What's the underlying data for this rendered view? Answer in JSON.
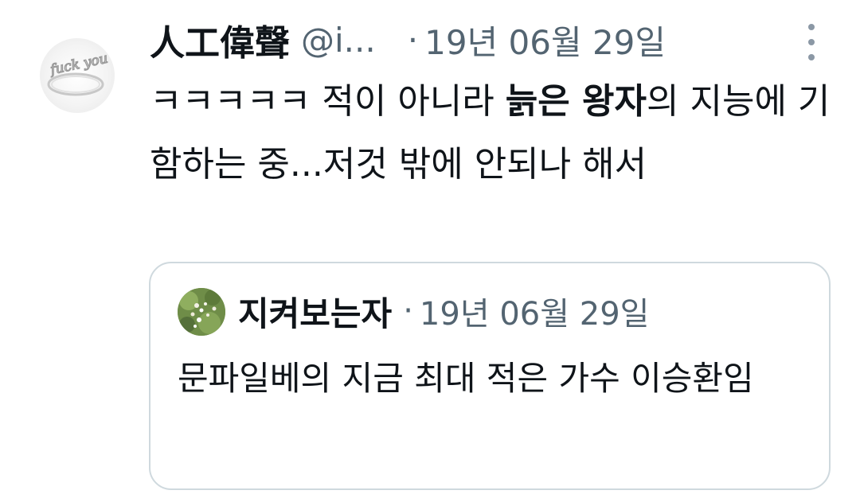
{
  "tweet": {
    "display_name": "人工偉聲",
    "handle": "@i...",
    "separator": "·",
    "date": "19년 06월 29일",
    "avatar_text": "fuck you",
    "text_part1": "ㅋㅋㅋㅋㅋ 적이 아니라 ",
    "text_bold": "늙은 왕자",
    "text_part2": "의 지능에 기함하는 중...저것 밖에 안되나 해서"
  },
  "quote": {
    "display_name": "지켜보는자",
    "separator": "·",
    "date": "19년 06월 29일",
    "text": "문파일베의 지금 최대 적은 가수 이승환임"
  },
  "colors": {
    "text": "#0f1419",
    "secondary": "#536471",
    "border": "#cfd9de"
  },
  "icons": {
    "more": "more-dots-icon"
  }
}
